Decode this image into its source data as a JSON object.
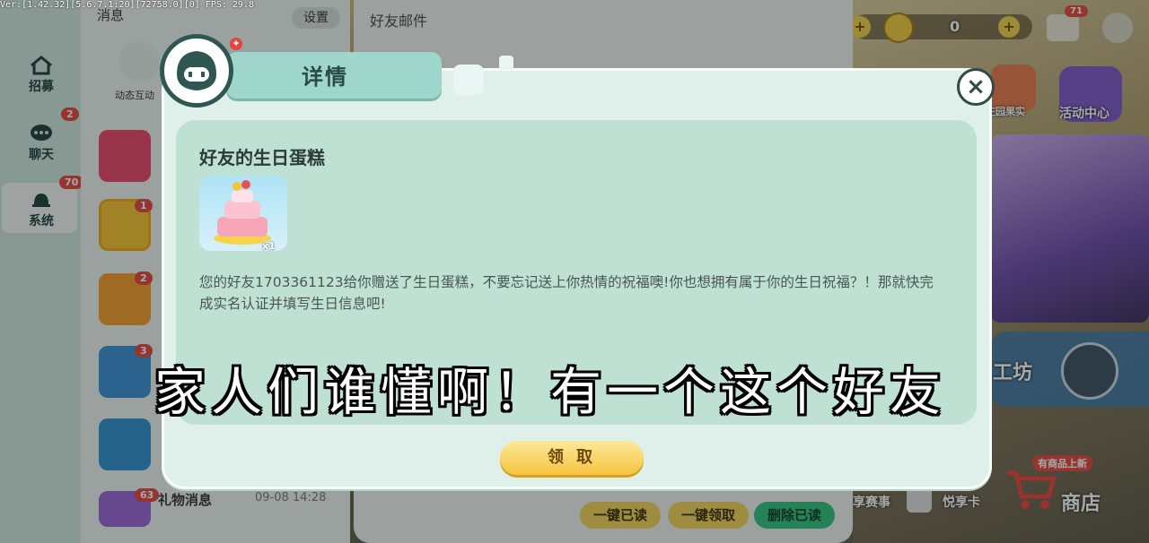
{
  "version_text": "Ver:[1.42.32][5.6.7.1:20][72758.0][0] FPS: 29.8",
  "left_nav": {
    "items": [
      {
        "label": "招募",
        "badge": ""
      },
      {
        "label": "聊天",
        "badge": "2"
      },
      {
        "label": "系统",
        "badge": "70"
      }
    ]
  },
  "messages_panel": {
    "title": "消息",
    "settings_label": "设置",
    "interaction_label": "动态互动",
    "badges": [
      "1",
      "2",
      "3"
    ],
    "gift_item": {
      "label": "礼物消息",
      "time": "09-08 14:28",
      "badge": "63"
    }
  },
  "mail_panel": {
    "title": "好友邮件",
    "actions": [
      "一键已读",
      "一键领取",
      "删除已读"
    ]
  },
  "dialog": {
    "tab_title": "详情",
    "gift_title": "好友的生日蛋糕",
    "item_quantity": "x1",
    "description": "您的好友1703361123给你赠送了生日蛋糕，不要忘记送上你热情的祝福噢!你也想拥有属于你的生日祝福？！那就快完成实名认证并填写生日信息吧!",
    "claim_label": "领 取",
    "close_symbol": "×"
  },
  "hud": {
    "currency_value": "0",
    "mail_badge": "71",
    "orchard_label": "庄园果实",
    "activity_label": "活动中心",
    "workshop_label": "工坊",
    "shop_label": "商店",
    "new_items_label": "有商品上新",
    "race_label": "享赛事",
    "card_label": "悦享卡"
  },
  "caption": "家人们谁懂啊！有一个这个好友",
  "colors": {
    "nav_bg": "#cfe5de",
    "dialog_bg": "#dff0ea",
    "inner_bg": "#bfe1d4",
    "tab_bg": "#9ed6cb",
    "claim_button": "#f5c43f",
    "badge_red": "#e2453e",
    "action_yellow": "#f2d25a",
    "action_green": "#2fbf7b"
  }
}
